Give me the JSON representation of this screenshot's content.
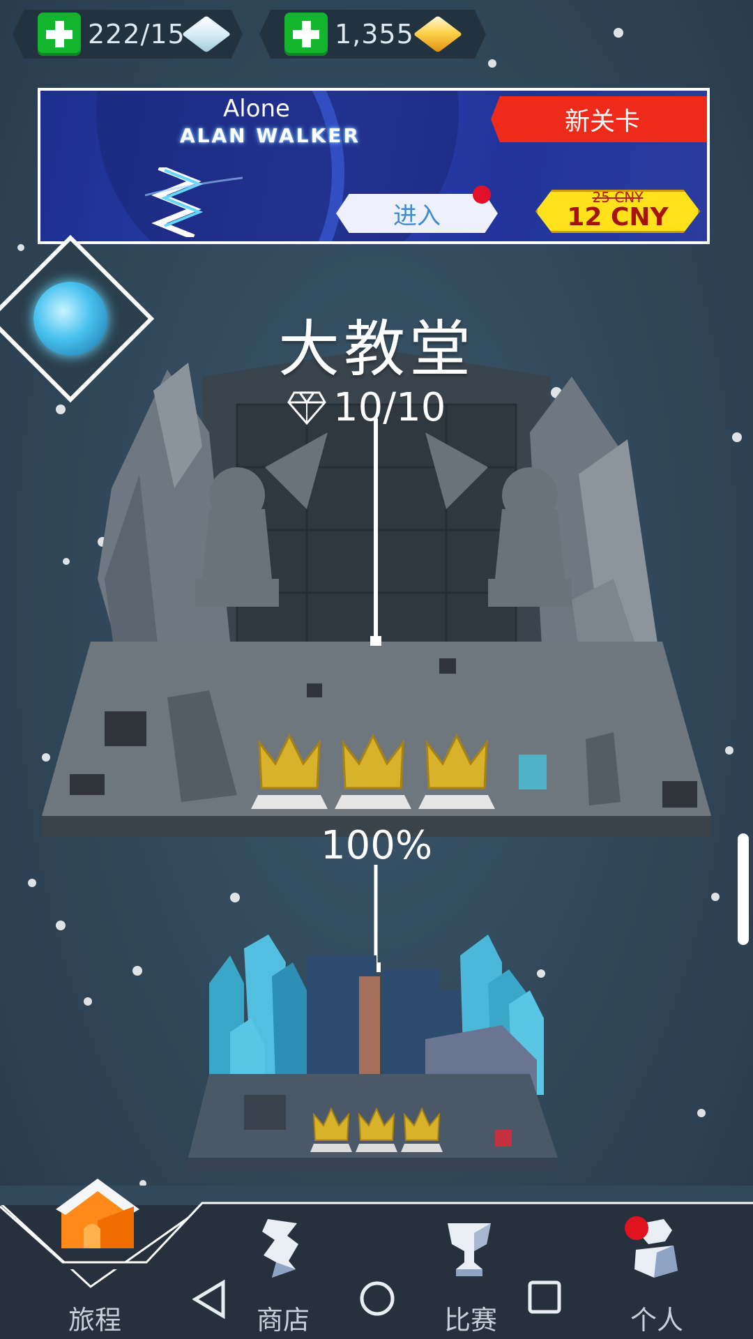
{
  "resources": {
    "energy": "222/15",
    "gems": "1,355"
  },
  "banner": {
    "song_title": "Alone",
    "song_artist": "ALAN WALKER",
    "tag": "新关卡",
    "enter_label": "进入",
    "old_price": "25 CNY",
    "new_price": "12 CNY"
  },
  "level": {
    "title": "大教堂",
    "gems_collected": "10/10",
    "progress": "100%",
    "crowns_earned": 3
  },
  "next_level": {
    "crowns_earned": 3
  },
  "nav": {
    "journey": "旅程",
    "shop": "商店",
    "contest": "比赛",
    "profile": "个人"
  },
  "icons": {
    "energy": "ice-cube-icon",
    "gems": "gold-gem-icon",
    "world": "globe-icon",
    "home": "house-icon",
    "shop": "shop-icon",
    "contest": "trophy-icon",
    "profile": "person-icon"
  }
}
